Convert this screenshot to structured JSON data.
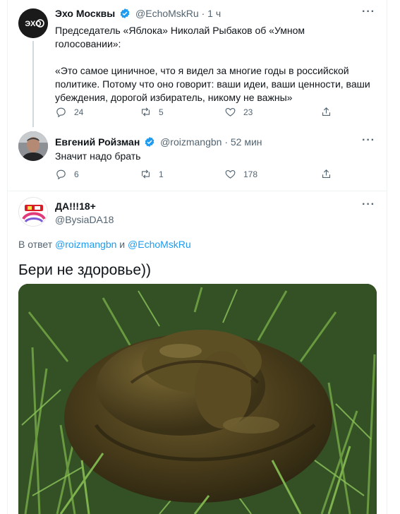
{
  "tweets": [
    {
      "name": "Эхо Москвы",
      "handle": "@EchoMskRu",
      "time": "· 1 ч",
      "avatar_text": "ЭХО",
      "text": "Председатель «Яблока» Николай Рыбаков об «Умном голосовании»:\n\n«Это самое циничное, что я видел за многие годы в российской политике. Потому что оно говорит: ваши идеи, ваши ценности, ваши убеждения, дорогой избиратель, никому не важны»",
      "replies": "24",
      "retweets": "5",
      "likes": "23"
    },
    {
      "name": "Евгений Ройзман",
      "handle": "@roizmangbn",
      "time": "· 52 мин",
      "text": "Значит надо брать",
      "replies": "6",
      "retweets": "1",
      "likes": "178"
    }
  ],
  "focus_tweet": {
    "name": "ДА!!!18+",
    "handle": "@BysiaDA18",
    "reply_prefix": "В ответ",
    "reply_mention_1": "@roizmangbn",
    "reply_and": "и",
    "reply_mention_2": "@EchoMskRu",
    "text": "Бери не здоровье))"
  },
  "colors": {
    "accent": "#1d9bf0",
    "secondary_text": "#536471",
    "verified": "#1d9bf0"
  },
  "icons": [
    "verified-badge-icon",
    "more-icon",
    "reply-icon",
    "retweet-icon",
    "like-icon",
    "share-icon"
  ]
}
